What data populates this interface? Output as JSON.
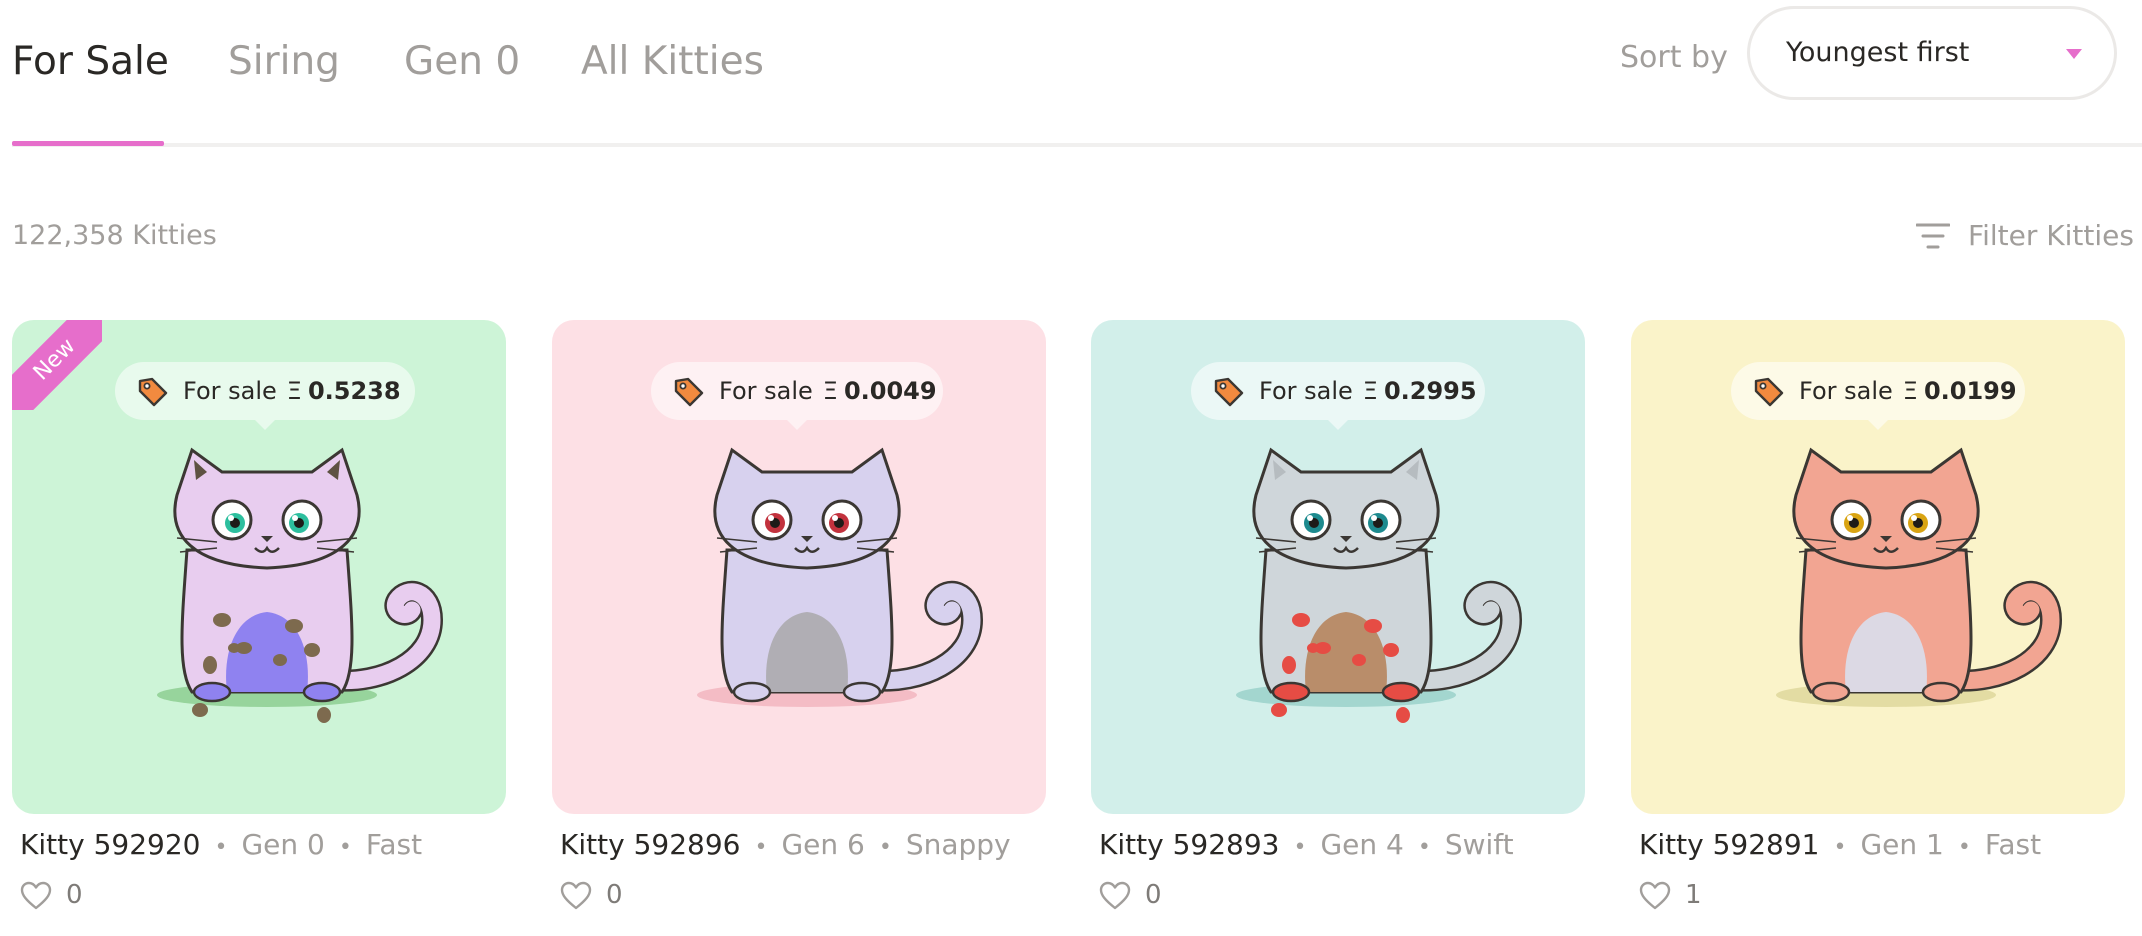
{
  "tabs": [
    {
      "label": "For Sale",
      "active": true
    },
    {
      "label": "Siring",
      "active": false
    },
    {
      "label": "Gen 0",
      "active": false
    },
    {
      "label": "All Kitties",
      "active": false
    }
  ],
  "sort": {
    "label": "Sort by",
    "value": "Youngest first"
  },
  "results": {
    "count": "122,358 Kitties",
    "filter_label": "Filter Kitties"
  },
  "colors": {
    "accent": "#e66ecb"
  },
  "cards": [
    {
      "ribbon": "New",
      "bg": "#cdf4d7",
      "sale_label": "For sale",
      "currency": "Ξ",
      "price": "0.5238",
      "name": "Kitty 592920",
      "gen": "Gen 0",
      "speed": "Fast",
      "likes": "0",
      "cat": {
        "body": "#e8cdef",
        "belly": "#8f82f0",
        "spots": "#7d6a4e",
        "ears": "#5e5242",
        "eyes": "#2dbf9e",
        "paws": "#8f82f0",
        "shadow": "#97d49c"
      }
    },
    {
      "ribbon": "",
      "bg": "#fde0e5",
      "sale_label": "For sale",
      "currency": "Ξ",
      "price": "0.0049",
      "name": "Kitty 592896",
      "gen": "Gen 6",
      "speed": "Snappy",
      "likes": "0",
      "cat": {
        "body": "#d7d1ee",
        "belly": "#b0aeb4",
        "spots": "",
        "ears": "#d7d1ee",
        "eyes": "#c2323d",
        "paws": "#d7d1ee",
        "shadow": "#f4bcc5"
      }
    },
    {
      "ribbon": "",
      "bg": "#d2efea",
      "sale_label": "For sale",
      "currency": "Ξ",
      "price": "0.2995",
      "name": "Kitty 592893",
      "gen": "Gen 4",
      "speed": "Swift",
      "likes": "0",
      "cat": {
        "body": "#cfd6da",
        "belly": "#b98d6a",
        "spots": "#e64c44",
        "ears": "#b6bcc0",
        "eyes": "#1d8a8e",
        "paws": "#e64c44",
        "shadow": "#a3d6cf"
      }
    },
    {
      "ribbon": "",
      "bg": "#faf3c9",
      "sale_label": "For sale",
      "currency": "Ξ",
      "price": "0.0199",
      "name": "Kitty 592891",
      "gen": "Gen 1",
      "speed": "Fast",
      "likes": "1",
      "cat": {
        "body": "#f2a592",
        "belly": "#dcd9e4",
        "spots": "",
        "ears": "#f2a592",
        "eyes": "#d9a413",
        "paws": "#f2a592",
        "shadow": "#e3dca3"
      }
    }
  ]
}
